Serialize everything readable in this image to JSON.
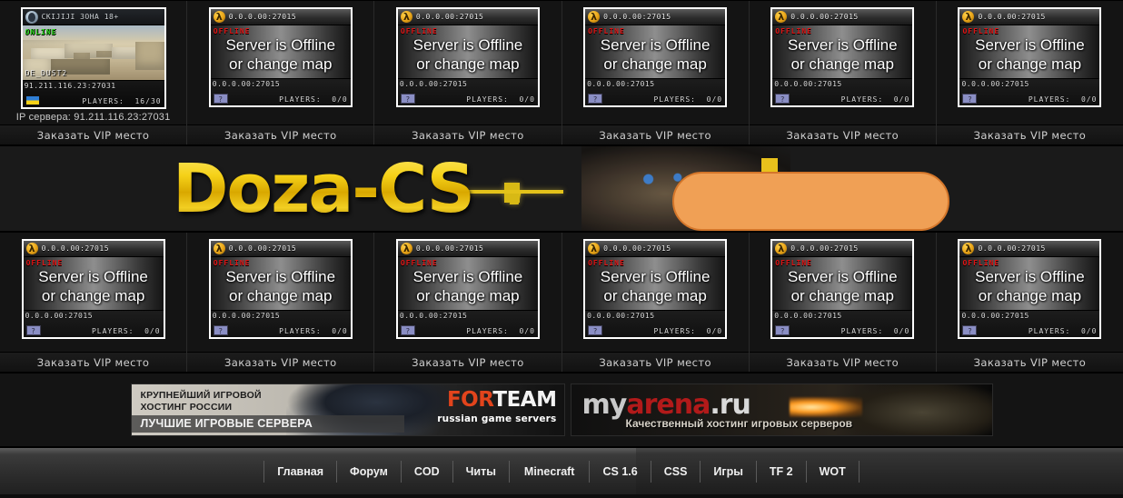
{
  "site": {
    "logo_text": "Doza-CS"
  },
  "server_rows": [
    {
      "cells": [
        {
          "status": "ONLINE",
          "status_label": "ONLINE",
          "title": "CKIJIJI 3OHA 18+",
          "header_ip": "CKIJIJI 3OHA 18+",
          "map": "DE_DUST2",
          "footer_ip": "91.211.116.23:27031",
          "players_label": "PLAYERS:",
          "players": "16/30",
          "ip_line": "IP сервера: 91.211.116.23:27031",
          "flag": "ua",
          "icon": "ct-player-icon",
          "vip_label": "Заказать VIP место"
        },
        {
          "status": "OFFLINE",
          "status_label": "OFFLINE",
          "header_ip": "0.0.0.00:27015",
          "message_line1": "Server is Offline",
          "message_line2": "or change map",
          "footer_ip": "0.0.0.00:27015",
          "players_label": "PLAYERS:",
          "players": "0/0",
          "flag": "unknown",
          "icon": "lambda-icon",
          "vip_label": "Заказать VIP место"
        },
        {
          "status": "OFFLINE",
          "status_label": "OFFLINE",
          "header_ip": "0.0.0.00:27015",
          "message_line1": "Server is Offline",
          "message_line2": "or change map",
          "footer_ip": "0.0.0.00:27015",
          "players_label": "PLAYERS:",
          "players": "0/0",
          "flag": "unknown",
          "icon": "lambda-icon",
          "vip_label": "Заказать VIP место"
        },
        {
          "status": "OFFLINE",
          "status_label": "OFFLINE",
          "header_ip": "0.0.0.00:27015",
          "message_line1": "Server is Offline",
          "message_line2": "or change map",
          "footer_ip": "0.0.0.00:27015",
          "players_label": "PLAYERS:",
          "players": "0/0",
          "flag": "unknown",
          "icon": "lambda-icon",
          "vip_label": "Заказать VIP место"
        },
        {
          "status": "OFFLINE",
          "status_label": "OFFLINE",
          "header_ip": "0.0.0.00:27015",
          "message_line1": "Server is Offline",
          "message_line2": "or change map",
          "footer_ip": "0.0.0.00:27015",
          "players_label": "PLAYERS:",
          "players": "0/0",
          "flag": "unknown",
          "icon": "lambda-icon",
          "vip_label": "Заказать VIP место"
        },
        {
          "status": "OFFLINE",
          "status_label": "OFFLINE",
          "header_ip": "0.0.0.00:27015",
          "message_line1": "Server is Offline",
          "message_line2": "or change map",
          "footer_ip": "0.0.0.00:27015",
          "players_label": "PLAYERS:",
          "players": "0/0",
          "flag": "unknown",
          "icon": "lambda-icon",
          "vip_label": "Заказать VIP место"
        }
      ]
    },
    {
      "cells": [
        {
          "status": "OFFLINE",
          "status_label": "OFFLINE",
          "header_ip": "0.0.0.00:27015",
          "message_line1": "Server is Offline",
          "message_line2": "or change map",
          "footer_ip": "0.0.0.00:27015",
          "players_label": "PLAYERS:",
          "players": "0/0",
          "flag": "unknown",
          "icon": "lambda-icon",
          "vip_label": "Заказать VIP место"
        },
        {
          "status": "OFFLINE",
          "status_label": "OFFLINE",
          "header_ip": "0.0.0.00:27015",
          "message_line1": "Server is Offline",
          "message_line2": "or change map",
          "footer_ip": "0.0.0.00:27015",
          "players_label": "PLAYERS:",
          "players": "0/0",
          "flag": "unknown",
          "icon": "lambda-icon",
          "vip_label": "Заказать VIP место"
        },
        {
          "status": "OFFLINE",
          "status_label": "OFFLINE",
          "header_ip": "0.0.0.00:27015",
          "message_line1": "Server is Offline",
          "message_line2": "or change map",
          "footer_ip": "0.0.0.00:27015",
          "players_label": "PLAYERS:",
          "players": "0/0",
          "flag": "unknown",
          "icon": "lambda-icon",
          "vip_label": "Заказать VIP место"
        },
        {
          "status": "OFFLINE",
          "status_label": "OFFLINE",
          "header_ip": "0.0.0.00:27015",
          "message_line1": "Server is Offline",
          "message_line2": "or change map",
          "footer_ip": "0.0.0.00:27015",
          "players_label": "PLAYERS:",
          "players": "0/0",
          "flag": "unknown",
          "icon": "lambda-icon",
          "vip_label": "Заказать VIP место"
        },
        {
          "status": "OFFLINE",
          "status_label": "OFFLINE",
          "header_ip": "0.0.0.00:27015",
          "message_line1": "Server is Offline",
          "message_line2": "or change map",
          "footer_ip": "0.0.0.00:27015",
          "players_label": "PLAYERS:",
          "players": "0/0",
          "flag": "unknown",
          "icon": "lambda-icon",
          "vip_label": "Заказать VIP место"
        },
        {
          "status": "OFFLINE",
          "status_label": "OFFLINE",
          "header_ip": "0.0.0.00:27015",
          "message_line1": "Server is Offline",
          "message_line2": "or change map",
          "footer_ip": "0.0.0.00:27015",
          "players_label": "PLAYERS:",
          "players": "0/0",
          "flag": "unknown",
          "icon": "lambda-icon",
          "vip_label": "Заказать VIP место"
        }
      ]
    }
  ],
  "ads": [
    {
      "name": "forteam",
      "line1": "КРУПНЕЙШИЙ ИГРОВОЙ",
      "line2": "ХОСТИНГ РОССИИ",
      "band": "ЛУЧШИЕ ИГРОВЫЕ СЕРВЕРА",
      "logo_part1": "FOR",
      "logo_part2": "TEAM",
      "tagline": "russian game servers"
    },
    {
      "name": "myarena",
      "logo_part1": "my",
      "logo_part2": "arena",
      "logo_part3": ".ru",
      "tagline": "Качественный хостинг игровых серверов"
    }
  ],
  "nav": {
    "items": [
      {
        "label": "Главная"
      },
      {
        "label": "Форум"
      },
      {
        "label": "COD"
      },
      {
        "label": "Читы"
      },
      {
        "label": "Minecraft"
      },
      {
        "label": "CS 1.6"
      },
      {
        "label": "CSS"
      },
      {
        "label": "Игры"
      },
      {
        "label": "TF 2"
      },
      {
        "label": "WOT"
      }
    ]
  },
  "colors": {
    "accent_yellow": "#f0c419",
    "offline_red": "#e01414",
    "online_green": "#2bd71d",
    "overlay_orange": "#f0a055",
    "page_bg": "#141414"
  }
}
